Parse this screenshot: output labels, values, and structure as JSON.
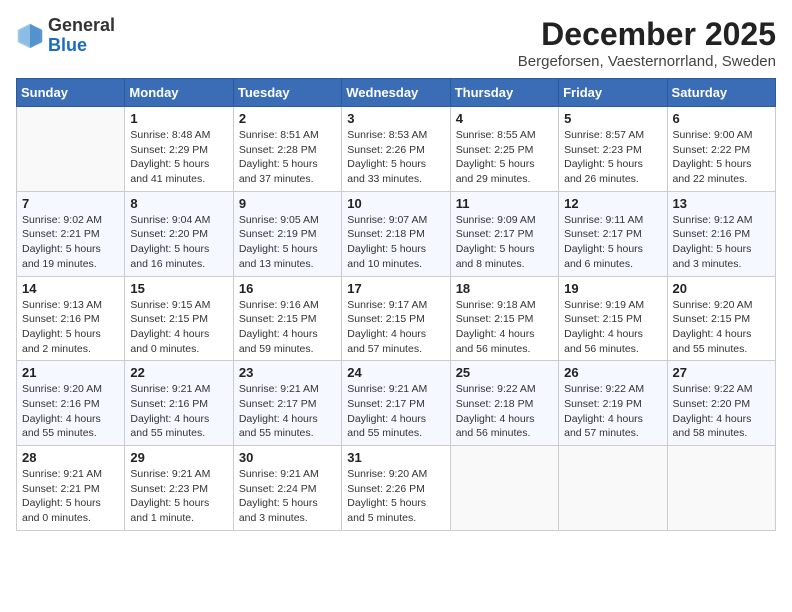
{
  "header": {
    "logo_general": "General",
    "logo_blue": "Blue",
    "month_title": "December 2025",
    "subtitle": "Bergeforsen, Vaesternorrland, Sweden"
  },
  "weekdays": [
    "Sunday",
    "Monday",
    "Tuesday",
    "Wednesday",
    "Thursday",
    "Friday",
    "Saturday"
  ],
  "weeks": [
    [
      {
        "day": "",
        "info": ""
      },
      {
        "day": "1",
        "info": "Sunrise: 8:48 AM\nSunset: 2:29 PM\nDaylight: 5 hours\nand 41 minutes."
      },
      {
        "day": "2",
        "info": "Sunrise: 8:51 AM\nSunset: 2:28 PM\nDaylight: 5 hours\nand 37 minutes."
      },
      {
        "day": "3",
        "info": "Sunrise: 8:53 AM\nSunset: 2:26 PM\nDaylight: 5 hours\nand 33 minutes."
      },
      {
        "day": "4",
        "info": "Sunrise: 8:55 AM\nSunset: 2:25 PM\nDaylight: 5 hours\nand 29 minutes."
      },
      {
        "day": "5",
        "info": "Sunrise: 8:57 AM\nSunset: 2:23 PM\nDaylight: 5 hours\nand 26 minutes."
      },
      {
        "day": "6",
        "info": "Sunrise: 9:00 AM\nSunset: 2:22 PM\nDaylight: 5 hours\nand 22 minutes."
      }
    ],
    [
      {
        "day": "7",
        "info": "Sunrise: 9:02 AM\nSunset: 2:21 PM\nDaylight: 5 hours\nand 19 minutes."
      },
      {
        "day": "8",
        "info": "Sunrise: 9:04 AM\nSunset: 2:20 PM\nDaylight: 5 hours\nand 16 minutes."
      },
      {
        "day": "9",
        "info": "Sunrise: 9:05 AM\nSunset: 2:19 PM\nDaylight: 5 hours\nand 13 minutes."
      },
      {
        "day": "10",
        "info": "Sunrise: 9:07 AM\nSunset: 2:18 PM\nDaylight: 5 hours\nand 10 minutes."
      },
      {
        "day": "11",
        "info": "Sunrise: 9:09 AM\nSunset: 2:17 PM\nDaylight: 5 hours\nand 8 minutes."
      },
      {
        "day": "12",
        "info": "Sunrise: 9:11 AM\nSunset: 2:17 PM\nDaylight: 5 hours\nand 6 minutes."
      },
      {
        "day": "13",
        "info": "Sunrise: 9:12 AM\nSunset: 2:16 PM\nDaylight: 5 hours\nand 3 minutes."
      }
    ],
    [
      {
        "day": "14",
        "info": "Sunrise: 9:13 AM\nSunset: 2:16 PM\nDaylight: 5 hours\nand 2 minutes."
      },
      {
        "day": "15",
        "info": "Sunrise: 9:15 AM\nSunset: 2:15 PM\nDaylight: 4 hours\nand 0 minutes."
      },
      {
        "day": "16",
        "info": "Sunrise: 9:16 AM\nSunset: 2:15 PM\nDaylight: 4 hours\nand 59 minutes."
      },
      {
        "day": "17",
        "info": "Sunrise: 9:17 AM\nSunset: 2:15 PM\nDaylight: 4 hours\nand 57 minutes."
      },
      {
        "day": "18",
        "info": "Sunrise: 9:18 AM\nSunset: 2:15 PM\nDaylight: 4 hours\nand 56 minutes."
      },
      {
        "day": "19",
        "info": "Sunrise: 9:19 AM\nSunset: 2:15 PM\nDaylight: 4 hours\nand 56 minutes."
      },
      {
        "day": "20",
        "info": "Sunrise: 9:20 AM\nSunset: 2:15 PM\nDaylight: 4 hours\nand 55 minutes."
      }
    ],
    [
      {
        "day": "21",
        "info": "Sunrise: 9:20 AM\nSunset: 2:16 PM\nDaylight: 4 hours\nand 55 minutes."
      },
      {
        "day": "22",
        "info": "Sunrise: 9:21 AM\nSunset: 2:16 PM\nDaylight: 4 hours\nand 55 minutes."
      },
      {
        "day": "23",
        "info": "Sunrise: 9:21 AM\nSunset: 2:17 PM\nDaylight: 4 hours\nand 55 minutes."
      },
      {
        "day": "24",
        "info": "Sunrise: 9:21 AM\nSunset: 2:17 PM\nDaylight: 4 hours\nand 55 minutes."
      },
      {
        "day": "25",
        "info": "Sunrise: 9:22 AM\nSunset: 2:18 PM\nDaylight: 4 hours\nand 56 minutes."
      },
      {
        "day": "26",
        "info": "Sunrise: 9:22 AM\nSunset: 2:19 PM\nDaylight: 4 hours\nand 57 minutes."
      },
      {
        "day": "27",
        "info": "Sunrise: 9:22 AM\nSunset: 2:20 PM\nDaylight: 4 hours\nand 58 minutes."
      }
    ],
    [
      {
        "day": "28",
        "info": "Sunrise: 9:21 AM\nSunset: 2:21 PM\nDaylight: 5 hours\nand 0 minutes."
      },
      {
        "day": "29",
        "info": "Sunrise: 9:21 AM\nSunset: 2:23 PM\nDaylight: 5 hours\nand 1 minute."
      },
      {
        "day": "30",
        "info": "Sunrise: 9:21 AM\nSunset: 2:24 PM\nDaylight: 5 hours\nand 3 minutes."
      },
      {
        "day": "31",
        "info": "Sunrise: 9:20 AM\nSunset: 2:26 PM\nDaylight: 5 hours\nand 5 minutes."
      },
      {
        "day": "",
        "info": ""
      },
      {
        "day": "",
        "info": ""
      },
      {
        "day": "",
        "info": ""
      }
    ]
  ]
}
